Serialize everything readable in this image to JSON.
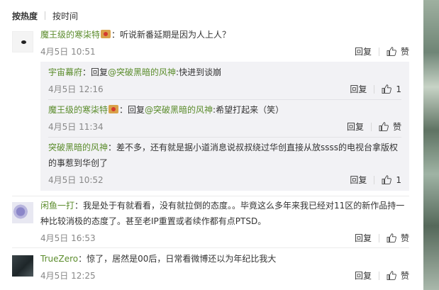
{
  "sort": {
    "hot": "按热度",
    "time": "按时间"
  },
  "actions": {
    "reply": "回复",
    "like": "赞"
  },
  "comments": [
    {
      "user": "魔王级的寒柒特",
      "text": "：听说新番延期是因为人上人？",
      "time": "4月5日 10:51",
      "replies": [
        {
          "user": "宇宙幕府",
          "prefix": "：回复",
          "at": "@突破黑暗的风神",
          "text": ":快进到谈崩",
          "time": "4月5日 12:16",
          "likes": "1"
        },
        {
          "user": "魔王级的寒柒特",
          "prefix": "：回复",
          "at": "@突破黑暗的风神",
          "text": ":希望打起来（笑）",
          "time": "4月5日 11:34",
          "likes": ""
        },
        {
          "user": "突破黑暗的风神",
          "text1": "：差不多，还有就是据小道消息说叔叔绕过华创直接从放ssss的电视台拿版权",
          "text2": "的事惹到华创了",
          "time": "4月5日 10:52",
          "likes": "1"
        }
      ]
    },
    {
      "user": "闲鱼一打",
      "text1": "：我是处于有就看看，没有就拉倒的态度。。毕竟这么多年来我已经对11区的新作品持一",
      "text2": "种比较消极的态度了。甚至老IP重置或者续作都有点PTSD。",
      "time": "4月5日 16:53"
    },
    {
      "user": "TrueZero",
      "text": "：惊了，居然是00后，日常看微博还以为年纪比我大",
      "time": "4月5日 12:25"
    }
  ]
}
